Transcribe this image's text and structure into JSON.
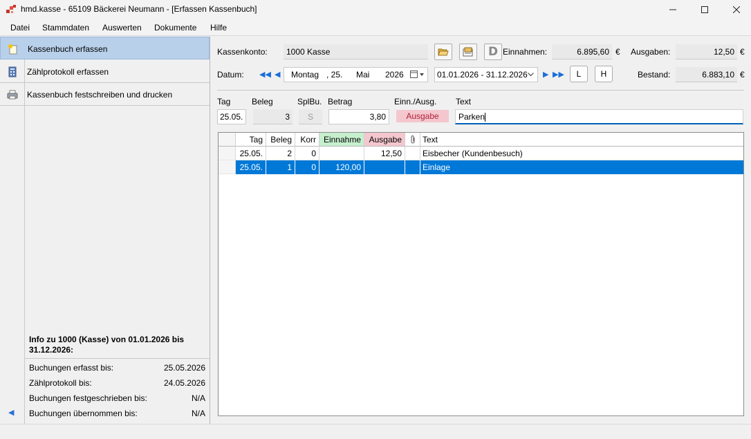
{
  "window": {
    "title": "hmd.kasse - 65109 Bäckerei Neumann - [Erfassen Kassenbuch]"
  },
  "menu": [
    "Datei",
    "Stammdaten",
    "Auswerten",
    "Dokumente",
    "Hilfe"
  ],
  "nav": {
    "items": [
      {
        "label": "Kassenbuch erfassen",
        "icon": "new-document-icon",
        "active": true
      },
      {
        "label": "Zählprotokoll erfassen",
        "icon": "calculator-icon",
        "active": false
      },
      {
        "label": "Kassenbuch festschreiben und drucken",
        "icon": "printer-icon",
        "active": false
      }
    ]
  },
  "info": {
    "title": "Info zu 1000 (Kasse) von 01.01.2026 bis 31.12.2026:",
    "rows": [
      {
        "label": "Buchungen erfasst bis:",
        "value": "25.05.2026"
      },
      {
        "label": "Zählprotokoll bis:",
        "value": "24.05.2026"
      },
      {
        "label": "Buchungen festgeschrieben bis:",
        "value": "N/A"
      },
      {
        "label": "Buchungen übernommen bis:",
        "value": "N/A"
      }
    ]
  },
  "header": {
    "kassenkonto_label": "Kassenkonto:",
    "kassenkonto_value": "1000 Kasse",
    "einnahmen_label": "Einnahmen:",
    "einnahmen_value": "6.895,60",
    "ausgaben_label": "Ausgaben:",
    "ausgaben_value": "12,50",
    "bestand_label": "Bestand:",
    "bestand_value": "6.883,10",
    "currency": "€",
    "datum_label": "Datum:",
    "datum_weekday": "Montag",
    "datum_day": ", 25.",
    "datum_month": "Mai",
    "datum_year": "2026",
    "period": "01.01.2026 - 31.12.2026",
    "btn_l": "L",
    "btn_h": "H",
    "d_button": "D"
  },
  "entry": {
    "labels": {
      "tag": "Tag",
      "beleg": "Beleg",
      "splbu": "SplBu.",
      "betrag": "Betrag",
      "einn_ausg": "Einn./Ausg.",
      "text": "Text"
    },
    "tag": "25.05.",
    "beleg": "3",
    "splbu": "S",
    "betrag": "3,80",
    "einn_ausg": "Ausgabe",
    "text": "Parken"
  },
  "grid": {
    "columns": [
      "Tag",
      "Beleg",
      "Korr",
      "Einnahme",
      "Ausgabe",
      "",
      "Text"
    ],
    "rows": [
      {
        "tag": "25.05.",
        "beleg": "2",
        "korr": "0",
        "einnahme": "",
        "ausgabe": "12,50",
        "att": "",
        "text": "Eisbecher (Kundenbesuch)",
        "selected": false
      },
      {
        "tag": "25.05.",
        "beleg": "1",
        "korr": "0",
        "einnahme": "120,00",
        "ausgabe": "",
        "att": "",
        "text": "Einlage",
        "selected": true
      }
    ]
  },
  "colors": {
    "einnahme_header": "#c6efce",
    "ausgabe_header": "#f4c7ce",
    "selection": "#0078d7",
    "nav_active": "#b8d0ea"
  }
}
